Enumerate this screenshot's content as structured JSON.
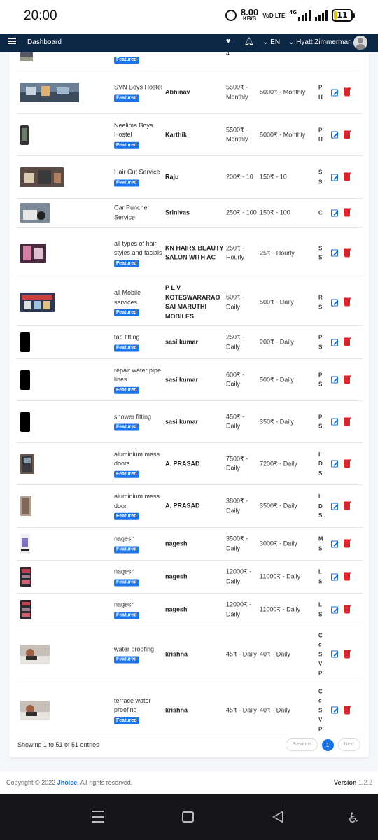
{
  "status_bar": {
    "time": "20:00",
    "speed_value": "8.00",
    "speed_unit": "KB/S",
    "volte": "VoD LTE",
    "network": "4G",
    "battery": "11"
  },
  "nav": {
    "dashboard_label": "Dashboard",
    "language": "EN",
    "user_name": "Hyatt Zimmerman"
  },
  "partial_row": {
    "badge": "Featured",
    "current_price": "4"
  },
  "rows": [
    {
      "name": "SVN Boys Hostel",
      "badge": "Featured",
      "provider": "Abhinav",
      "current_price": "5500₹ - Monthly",
      "offer_price": "5000₹ - Monthly",
      "desc": "P H",
      "thumb": "street"
    },
    {
      "name": "Neelima Boys Hostel",
      "badge": "Featured",
      "provider": "Karthik",
      "current_price": "5500₹ - Monthly",
      "offer_price": "5000₹ - Monthly",
      "desc": "P H",
      "thumb": "phone"
    },
    {
      "name": "Hair Cut Service",
      "badge": "Featured",
      "provider": "Raju",
      "current_price": "200₹ - 10",
      "offer_price": "150₹ - 10",
      "desc": "S S",
      "thumb": "shop"
    },
    {
      "name": "Car Puncher Service",
      "badge": "",
      "provider": "Srinivas",
      "current_price": "250₹ - 100",
      "offer_price": "150₹ - 100",
      "desc": "C",
      "thumb": "garage"
    },
    {
      "name": "all types of hair styles and facials",
      "badge": "Featured",
      "provider": "KN HAIR& BEAUTY SALON WITH AC",
      "current_price": "250₹ - Hourly",
      "offer_price": "25₹ - Hourly",
      "desc": "S S",
      "thumb": "salon"
    },
    {
      "name": "all Mobile services",
      "badge": "Featured",
      "provider": "P L V KOTESWARARAO SAI MARUTHI MOBILES",
      "current_price": "600₹ - Daily",
      "offer_price": "500₹ - Daily",
      "desc": "R S",
      "thumb": "store"
    },
    {
      "name": "tap fitting",
      "badge": "Featured",
      "provider": "sasi kumar",
      "current_price": "250₹ - Daily",
      "offer_price": "200₹ - Daily",
      "desc": "P S",
      "thumb": "black"
    },
    {
      "name": "repair water pipe lines",
      "badge": "Featured",
      "provider": "sasi kumar",
      "current_price": "600₹ - Daily",
      "offer_price": "500₹ - Daily",
      "desc": "P S",
      "thumb": "black"
    },
    {
      "name": "shower fitting",
      "badge": "Featured",
      "provider": "sasi kumar",
      "current_price": "450₹ - Daily",
      "offer_price": "350₹ - Daily",
      "desc": "P S",
      "thumb": "black"
    },
    {
      "name": "aluminium mess doors",
      "badge": "Featured",
      "provider": "A. PRASAD",
      "current_price": "7500₹ - Daily",
      "offer_price": "7200₹ - Daily",
      "desc": "I D S",
      "thumb": "door"
    },
    {
      "name": "aluminium mess door",
      "badge": "Featured",
      "provider": "A. PRASAD",
      "current_price": "3800₹ - Daily",
      "offer_price": "3500₹ - Daily",
      "desc": "I D S",
      "thumb": "door2"
    },
    {
      "name": "nagesh",
      "badge": "Featured",
      "provider": "nagesh",
      "current_price": "3500₹ - Daily",
      "offer_price": "3000₹ - Daily",
      "desc": "M S",
      "thumb": "mobile"
    },
    {
      "name": "nagesh",
      "badge": "Featured",
      "provider": "nagesh",
      "current_price": "12000₹ - Daily",
      "offer_price": "11000₹ - Daily",
      "desc": "L S",
      "thumb": "rack"
    },
    {
      "name": "nagesh",
      "badge": "Featured",
      "provider": "nagesh",
      "current_price": "12000₹ - Daily",
      "offer_price": "11000₹ - Daily",
      "desc": "L S",
      "thumb": "rack"
    },
    {
      "name": "water proofing",
      "badge": "Featured",
      "provider": "krishna",
      "current_price": "45₹ - Daily",
      "offer_price": "40₹ - Daily",
      "desc": "C c S V P",
      "thumb": "roof"
    },
    {
      "name": "terrace water proofing",
      "badge": "Featured",
      "provider": "krishna",
      "current_price": "45₹ - Daily",
      "offer_price": "40₹ - Daily",
      "desc": "C c S V P",
      "thumb": "roof"
    }
  ],
  "table_footer": {
    "entries_text": "Showing 1 to 51 of 51 entries",
    "prev_label": "Previous",
    "current_page": "1",
    "next_label": "Next"
  },
  "footer": {
    "copyright_prefix": "Copyright © 2022",
    "brand": "Jhoice.",
    "rights": "All rights reserved.",
    "version_label": "Version",
    "version_number": "1.2.2"
  },
  "colors": {
    "nav_bg": "#0d2746",
    "accent": "#1a73e8",
    "delete": "#d9232d"
  },
  "icons": [
    "alarm-icon",
    "signal-icon",
    "battery-icon",
    "menu-icon",
    "heart-icon",
    "bell-icon",
    "chevron-down-icon",
    "avatar-icon",
    "edit-icon",
    "trash-icon",
    "home-icon",
    "back-icon",
    "accessibility-icon"
  ]
}
